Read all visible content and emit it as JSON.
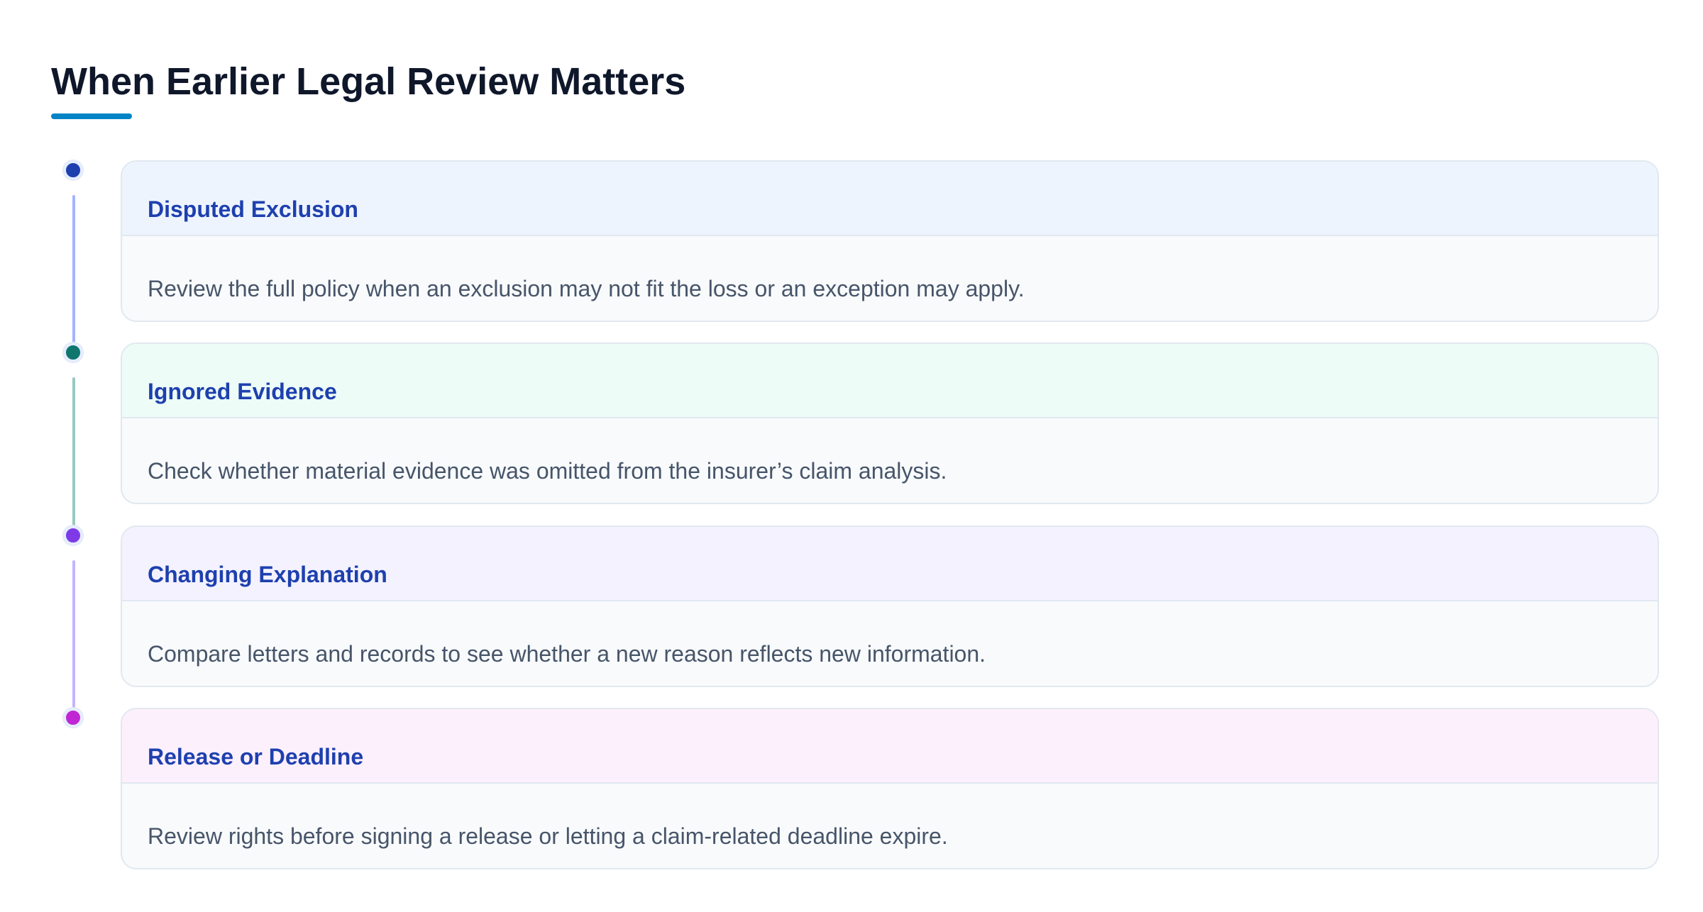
{
  "page": {
    "title": "When Earlier Legal Review Matters",
    "accent_color": "#0284c7"
  },
  "steps": [
    {
      "heading": "Disputed Exclusion",
      "description": "Review the full policy when an exclusion may not fit the loss or an exception may apply.",
      "dot_color": "#1e40af",
      "line_color": "#a5b4fc",
      "header_bg": "#eef4fe"
    },
    {
      "heading": "Ignored Evidence",
      "description": "Check whether material evidence was omitted from the insurer’s claim analysis.",
      "dot_color": "#0f766e",
      "line_color": "#99c9c0",
      "header_bg": "#edfcf7"
    },
    {
      "heading": "Changing Explanation",
      "description": "Compare letters and records to see whether a new reason reflects new information.",
      "dot_color": "#7e3ae6",
      "line_color": "#c4b5fd",
      "header_bg": "#f4f2fe"
    },
    {
      "heading": "Release or Deadline",
      "description": "Review rights before signing a release or letting a claim-related deadline expire.",
      "dot_color": "#c026d3",
      "line_color": "#f0abfc",
      "header_bg": "#fdf0fd"
    }
  ]
}
